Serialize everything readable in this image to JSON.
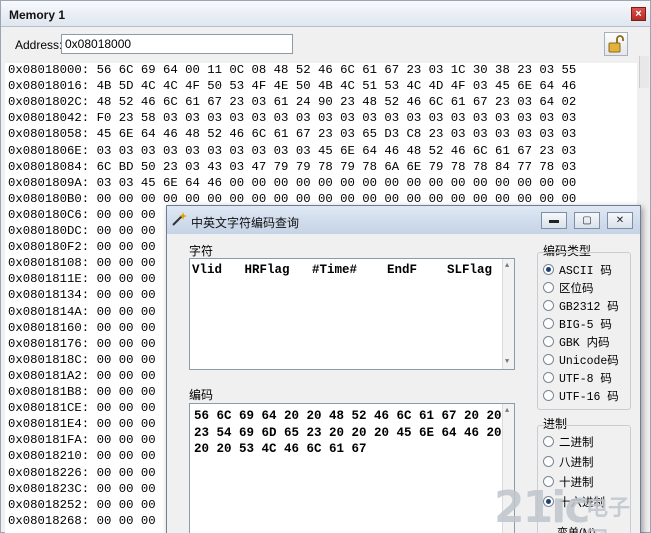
{
  "window": {
    "title": "Memory 1",
    "close": "×"
  },
  "toolbar": {
    "address_label": "Address:",
    "address_value": "0x08018000"
  },
  "memory": {
    "rows": [
      {
        "addr": "0x08018000:",
        "bytes": "56 6C 69 64 00 11 0C 08 48 52 46 6C 61 67 23 03 1C 30 38 23 03 55"
      },
      {
        "addr": "0x08018016:",
        "bytes": "4B 5D 4C 4C 4F 50 53 4F 4E 50 4B 4C 51 53 4C 4D 4F 03 45 6E 64 46"
      },
      {
        "addr": "0x0801802C:",
        "bytes": "48 52 46 6C 61 67 23 03 61 24 90 23 48 52 46 6C 61 67 23 03 64 02"
      },
      {
        "addr": "0x08018042:",
        "bytes": "F0 23 58 03 03 03 03 03 03 03 03 03 03 03 03 03 03 03 03 03 03 03"
      },
      {
        "addr": "0x08018058:",
        "bytes": "45 6E 64 46 48 52 46 6C 61 67 23 03 65 D3 C8 23 03 03 03 03 03 03"
      },
      {
        "addr": "0x0801806E:",
        "bytes": "03 03 03 03 03 03 03 03 03 03 45 6E 64 46 48 52 46 6C 61 67 23 03"
      },
      {
        "addr": "0x08018084:",
        "bytes": "6C BD 50 23 03 43 03 47 79 79 78 79 78 6A 6E 79 78 78 84 77 78 03"
      },
      {
        "addr": "0x0801809A:",
        "bytes": "03 03 45 6E 64 46 00 00 00 00 00 00 00 00 00 00 00 00 00 00 00 00"
      },
      {
        "addr": "0x080180B0:",
        "bytes": "00 00 00 00 00 00 00 00 00 00 00 00 00 00 00 00 00 00 00 00 00 00"
      },
      {
        "addr": "0x080180C6:",
        "bytes": "00 00 00"
      },
      {
        "addr": "0x080180DC:",
        "bytes": "00 00 00"
      },
      {
        "addr": "0x080180F2:",
        "bytes": "00 00 00"
      },
      {
        "addr": "0x08018108:",
        "bytes": "00 00 00"
      },
      {
        "addr": "0x0801811E:",
        "bytes": "00 00 00"
      },
      {
        "addr": "0x08018134:",
        "bytes": "00 00 00"
      },
      {
        "addr": "0x0801814A:",
        "bytes": "00 00 00"
      },
      {
        "addr": "0x08018160:",
        "bytes": "00 00 00"
      },
      {
        "addr": "0x08018176:",
        "bytes": "00 00 00"
      },
      {
        "addr": "0x0801818C:",
        "bytes": "00 00 00"
      },
      {
        "addr": "0x080181A2:",
        "bytes": "00 00 00"
      },
      {
        "addr": "0x080181B8:",
        "bytes": "00 00 00"
      },
      {
        "addr": "0x080181CE:",
        "bytes": "00 00 00"
      },
      {
        "addr": "0x080181E4:",
        "bytes": "00 00 00"
      },
      {
        "addr": "0x080181FA:",
        "bytes": "00 00 00"
      },
      {
        "addr": "0x08018210:",
        "bytes": "00 00 00"
      },
      {
        "addr": "0x08018226:",
        "bytes": "00 00 00"
      },
      {
        "addr": "0x0801823C:",
        "bytes": "00 00 00"
      },
      {
        "addr": "0x08018252:",
        "bytes": "00 00 00"
      },
      {
        "addr": "0x08018268:",
        "bytes": "00 00 00"
      }
    ]
  },
  "dialog": {
    "title": "中英文字符编码查询",
    "chars_label": "字符",
    "chars_value": "Vlid   HRFlag   #Time#    EndF    SLFlag",
    "hex_label": "编码",
    "hex_value": "56 6C 69 64 20 20 48 52 46 6C 61 67 20 20 23 54 69 6D 65 23 20 20 20 45 6E 64 46 20 20 20 53 4C 46 6C 61 67",
    "encoding_label": "编码类型",
    "encodings": [
      {
        "label": "ASCII 码",
        "checked": true
      },
      {
        "label": "区位码",
        "checked": false
      },
      {
        "label": "GB2312 码",
        "checked": false
      },
      {
        "label": "BIG-5 码",
        "checked": false
      },
      {
        "label": "GBK 内码",
        "checked": false
      },
      {
        "label": "Unicode码",
        "checked": false
      },
      {
        "label": "UTF-8 码",
        "checked": false
      },
      {
        "label": "UTF-16 码",
        "checked": false
      }
    ],
    "radix_label": "进制",
    "radixes": [
      {
        "label": "二进制",
        "checked": false
      },
      {
        "label": "八进制",
        "checked": false
      },
      {
        "label": "十进制",
        "checked": false
      },
      {
        "label": "十六进制",
        "checked": true
      }
    ],
    "bottom_partial": "变单(M)"
  },
  "watermark": {
    "text": "21ic",
    "cn": "电子网"
  }
}
